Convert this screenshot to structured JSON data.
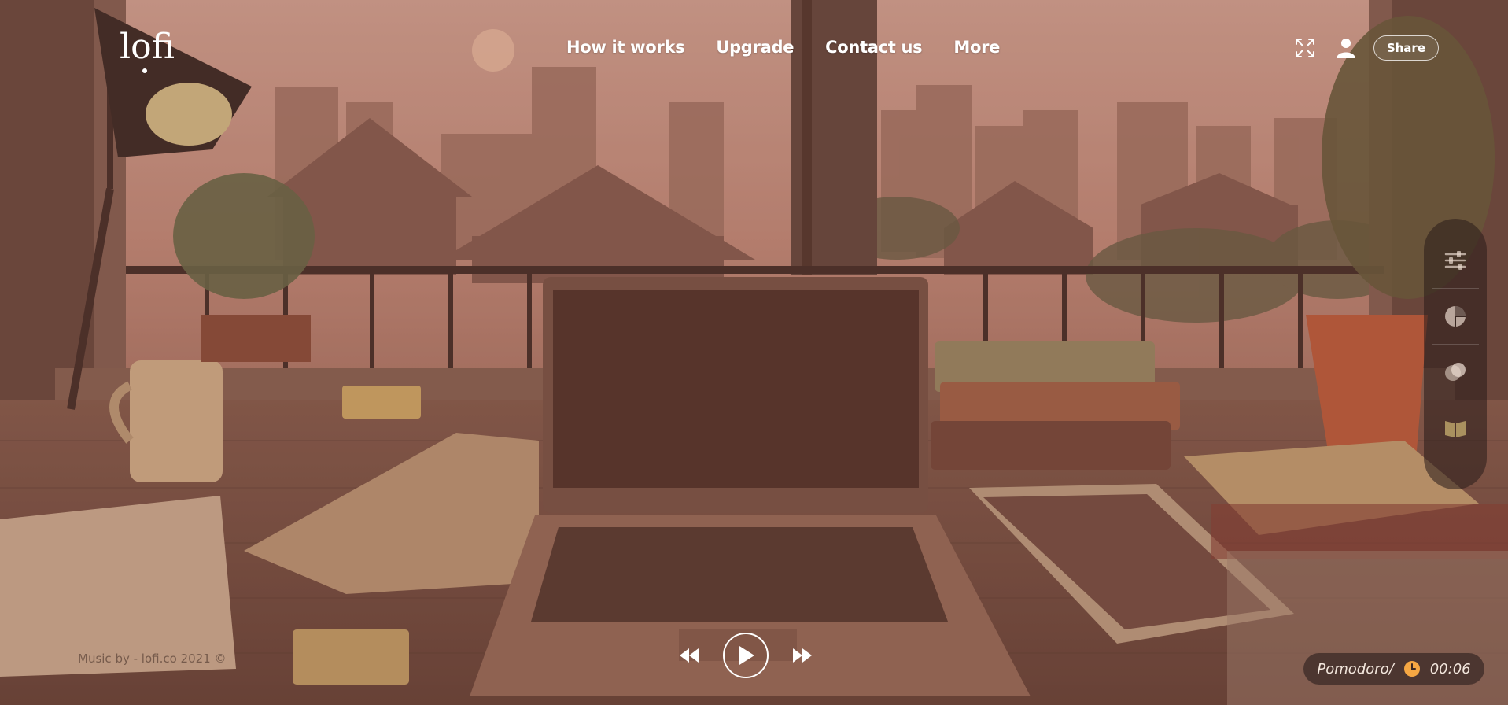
{
  "brand": {
    "logo_text": "lofi"
  },
  "nav": {
    "items": [
      {
        "label": "How it works"
      },
      {
        "label": "Upgrade"
      },
      {
        "label": "Contact us"
      },
      {
        "label": "More"
      }
    ]
  },
  "header_actions": {
    "fullscreen_icon": "fullscreen-icon",
    "user_icon": "user-icon",
    "share_label": "Share"
  },
  "side_panel": {
    "items": [
      {
        "icon": "sliders-icon"
      },
      {
        "icon": "pie-chart-icon"
      },
      {
        "icon": "scenes-icon"
      },
      {
        "icon": "book-icon"
      }
    ]
  },
  "player": {
    "prev_icon": "rewind-icon",
    "play_icon": "play-icon",
    "next_icon": "fast-forward-icon"
  },
  "footer": {
    "credit": "Music by - lofi.co 2021 ©"
  },
  "pomodoro": {
    "label": "Pomodoro/",
    "time": "00:06",
    "icon": "clock-icon"
  },
  "colors": {
    "sky": "#d9a08f",
    "wall": "#7a5448",
    "accent": "#f5a743"
  }
}
